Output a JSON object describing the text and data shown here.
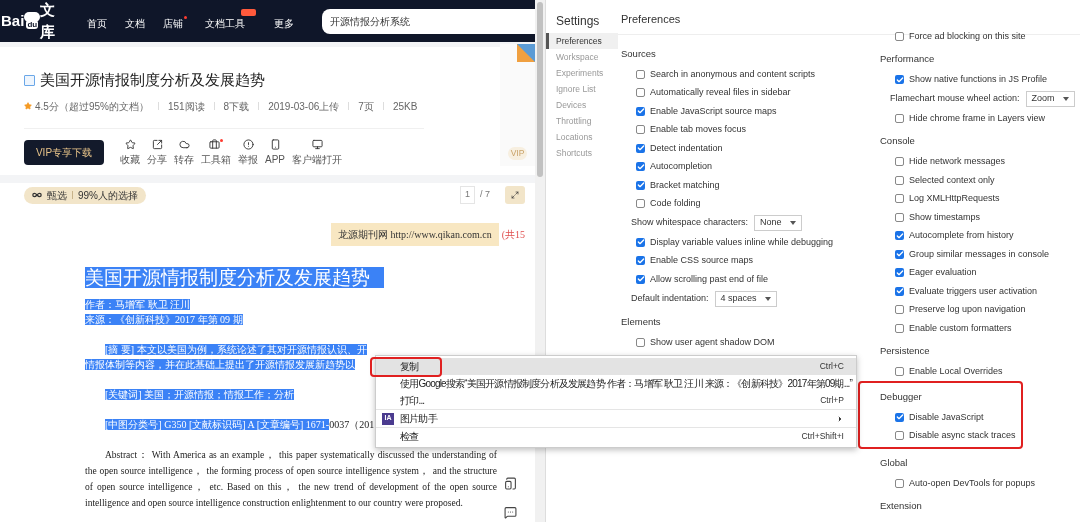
{
  "site_header": {
    "logo": {
      "text_left": "Bai",
      "paw_text": "du",
      "text_right": "文库"
    },
    "nav": [
      {
        "label": "首页",
        "dot": false,
        "badge": false
      },
      {
        "label": "文档",
        "dot": false,
        "badge": false
      },
      {
        "label": "店铺",
        "dot": true,
        "badge": false
      },
      {
        "label": "文档工具",
        "dot": false,
        "badge": true
      },
      {
        "label": "更多",
        "dot": false,
        "badge": false
      }
    ],
    "search": {
      "value": "开源情报分析系统"
    }
  },
  "doc_header": {
    "title": "美国开源情报制度分析及发展趋势",
    "meta": [
      "4.5分（超过95%的文档）",
      "151阅读",
      "8下载",
      "2019-03-06上传",
      "7页",
      "25KB"
    ],
    "download_button": "VIP专享下载",
    "actions": [
      {
        "kind": "star",
        "label": "收藏",
        "dot": false
      },
      {
        "kind": "share",
        "label": "分享",
        "dot": false
      },
      {
        "kind": "save",
        "label": "转存",
        "dot": false
      },
      {
        "kind": "toolbox",
        "label": "工具箱",
        "dot": true
      },
      {
        "kind": "report",
        "label": "举报",
        "dot": false
      },
      {
        "kind": "phone",
        "label": "APP",
        "dot": false
      },
      {
        "kind": "monitor",
        "label": "客户端打开",
        "dot": false
      }
    ],
    "thumbnail_badge": "VIP"
  },
  "toolbar": {
    "pick_label": "甄选",
    "pick_note": "99%人的选择",
    "page_current": "1",
    "page_total": "/ 7"
  },
  "document": {
    "banner": {
      "site": "龙源期刊网",
      "url": "http://www.qikan.com.cn"
    },
    "side_note": "(共15",
    "title": {
      "text": "美国开源情报制度分析及发展趋势",
      "selected": true
    },
    "lines": [
      {
        "kind": "byline",
        "gap_before": false,
        "parts": [
          {
            "text": "作者：马增军 耿卫 汪川",
            "selected": true
          }
        ]
      },
      {
        "kind": "byline",
        "gap_before": false,
        "parts": [
          {
            "text": "来源：《创新科技》2017 年第 09 期",
            "selected": true
          }
        ]
      },
      {
        "kind": "lead",
        "gap_before": true,
        "parts": [
          {
            "text": "[摘 要] 本文以美国为例，系统论述了其对开源情报认识、开",
            "selected": true
          }
        ]
      },
      {
        "kind": "body",
        "gap_before": false,
        "parts": [
          {
            "text": "情报体制等内容，并在此基础上提出了开源情报发展新趋势以",
            "selected": true
          }
        ]
      },
      {
        "kind": "lead",
        "gap_before": true,
        "parts": [
          {
            "text": "[关键词] 美国；开源情报；情报工作；分析",
            "selected": true
          }
        ]
      },
      {
        "kind": "lead",
        "gap_before": true,
        "parts": [
          {
            "text": "[中图分类号] G350 [文献标识码] A [文章编号] 1671-",
            "selected": true
          },
          {
            "text": "0037（201",
            "selected": false
          }
        ]
      }
    ],
    "abstract": "Abstract： With America as an example， this paper systematically discussed the understanding of the open source intelligence， the forming process of open source intelligence system， and the structure of open source intelligence， etc. Based on this， the new trend of development of the open source intelligence and open source intelligence construction enlightenment to our country were proposed."
  },
  "devtools": {
    "sidebar_title": "Settings",
    "page_title": "Preferences",
    "sidebar": [
      {
        "label": "Preferences",
        "selected": true
      },
      {
        "label": "Workspace",
        "selected": false
      },
      {
        "label": "Experiments",
        "selected": false
      },
      {
        "label": "Ignore List",
        "selected": false
      },
      {
        "label": "Devices",
        "selected": false
      },
      {
        "label": "Throttling",
        "selected": false
      },
      {
        "label": "Locations",
        "selected": false
      },
      {
        "label": "Shortcuts",
        "selected": false
      }
    ],
    "columns": [
      [
        {
          "title": "Sources",
          "outlined": false,
          "items": [
            {
              "kind": "checkbox",
              "label": "Search in anonymous and content scripts",
              "checked": false
            },
            {
              "kind": "checkbox",
              "label": "Automatically reveal files in sidebar",
              "checked": false
            },
            {
              "kind": "checkbox",
              "label": "Enable JavaScript source maps",
              "checked": true
            },
            {
              "kind": "checkbox",
              "label": "Enable tab moves focus",
              "checked": false
            },
            {
              "kind": "checkbox",
              "label": "Detect indentation",
              "checked": true
            },
            {
              "kind": "checkbox",
              "label": "Autocompletion",
              "checked": true
            },
            {
              "kind": "checkbox",
              "label": "Bracket matching",
              "checked": true
            },
            {
              "kind": "checkbox",
              "label": "Code folding",
              "checked": false
            },
            {
              "kind": "select",
              "label": "Show whitespace characters:",
              "value": "None"
            },
            {
              "kind": "checkbox",
              "label": "Display variable values inline while debugging",
              "checked": true
            },
            {
              "kind": "checkbox",
              "label": "Enable CSS source maps",
              "checked": true
            },
            {
              "kind": "checkbox",
              "label": "Allow scrolling past end of file",
              "checked": true
            },
            {
              "kind": "select",
              "label": "Default indentation:",
              "value": "4 spaces"
            }
          ]
        },
        {
          "title": "Elements",
          "outlined": false,
          "items": [
            {
              "kind": "checkbox",
              "label": "Show user agent shadow DOM",
              "checked": false
            }
          ]
        }
      ],
      [
        {
          "outlined": false,
          "items": [
            {
              "kind": "checkbox",
              "label": "Force ad blocking on this site",
              "checked": false
            }
          ]
        },
        {
          "title": "Performance",
          "outlined": false,
          "items": [
            {
              "kind": "checkbox",
              "label": "Show native functions in JS Profile",
              "checked": true
            },
            {
              "kind": "select",
              "label": "Flamechart mouse wheel action:",
              "value": "Zoom"
            },
            {
              "kind": "checkbox",
              "label": "Hide chrome frame in Layers view",
              "checked": false
            }
          ]
        },
        {
          "title": "Console",
          "outlined": false,
          "items": [
            {
              "kind": "checkbox",
              "label": "Hide network messages",
              "checked": false
            },
            {
              "kind": "checkbox",
              "label": "Selected context only",
              "checked": false
            },
            {
              "kind": "checkbox",
              "label": "Log XMLHttpRequests",
              "checked": false
            },
            {
              "kind": "checkbox",
              "label": "Show timestamps",
              "checked": false
            },
            {
              "kind": "checkbox",
              "label": "Autocomplete from history",
              "checked": true
            },
            {
              "kind": "checkbox",
              "label": "Group similar messages in console",
              "checked": true
            },
            {
              "kind": "checkbox",
              "label": "Eager evaluation",
              "checked": true
            },
            {
              "kind": "checkbox",
              "label": "Evaluate triggers user activation",
              "checked": true
            },
            {
              "kind": "checkbox",
              "label": "Preserve log upon navigation",
              "checked": false
            },
            {
              "kind": "checkbox",
              "label": "Enable custom formatters",
              "checked": false
            }
          ]
        },
        {
          "title": "Persistence",
          "outlined": false,
          "items": [
            {
              "kind": "checkbox",
              "label": "Enable Local Overrides",
              "checked": false
            }
          ]
        },
        {
          "title": "Debugger",
          "outlined": true,
          "items": [
            {
              "kind": "checkbox",
              "label": "Disable JavaScript",
              "checked": true
            },
            {
              "kind": "checkbox",
              "label": "Disable async stack traces",
              "checked": false
            }
          ]
        },
        {
          "title": "Global",
          "outlined": false,
          "items": [
            {
              "kind": "checkbox",
              "label": "Auto-open DevTools for popups",
              "checked": false
            }
          ]
        },
        {
          "title": "Extension",
          "outlined": false
        }
      ]
    ]
  },
  "context_menu": {
    "items": [
      {
        "kind": "item",
        "label": "复制",
        "shortcut": "Ctrl+C",
        "highlighted": true,
        "outlined": true,
        "separator_before": false
      },
      {
        "kind": "item",
        "label": "使用Google搜索“美国开源情报制度分析及发展趋势 作者：马增军 耿卫 汪川 来源：《创新科技》2017年第09期...”",
        "highlighted": false,
        "outlined": false,
        "separator_before": false
      },
      {
        "kind": "item",
        "label": "打印...",
        "shortcut": "Ctrl+P",
        "highlighted": false,
        "outlined": false,
        "separator_before": false
      },
      {
        "kind": "submenu",
        "label": "图片助手",
        "badge": "IA",
        "highlighted": false,
        "outlined": false,
        "separator_before": true
      },
      {
        "kind": "item",
        "label": "检查",
        "shortcut": "Ctrl+Shift+I",
        "highlighted": false,
        "outlined": false,
        "separator_before": true
      }
    ]
  }
}
